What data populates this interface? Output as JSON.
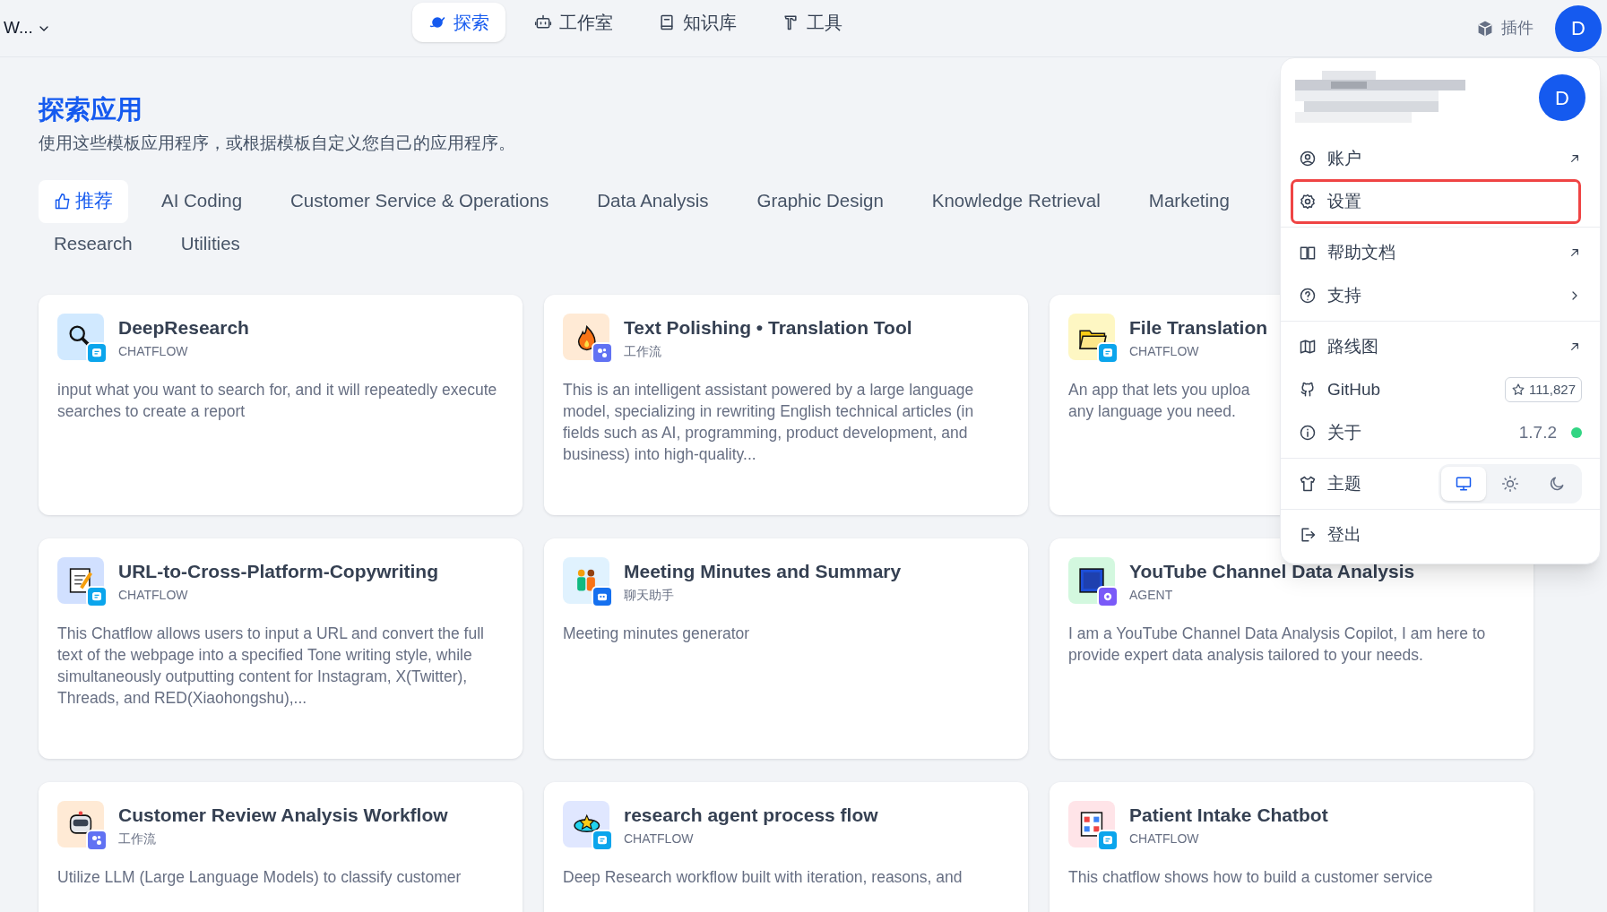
{
  "workspace": {
    "name": "W..."
  },
  "nav": [
    {
      "label": "探索",
      "selected": true
    },
    {
      "label": "工作室",
      "selected": false
    },
    {
      "label": "知识库",
      "selected": false
    },
    {
      "label": "工具",
      "selected": false
    }
  ],
  "plugins": {
    "label": "插件"
  },
  "avatar": {
    "initial": "D"
  },
  "page": {
    "title": "探索应用",
    "subtitle": "使用这些模板应用程序，或根据模板自定义您自己的应用程序。"
  },
  "categories": [
    {
      "label": "推荐",
      "selected": true
    },
    {
      "label": "AI Coding",
      "selected": false
    },
    {
      "label": "Customer Service & Operations",
      "selected": false
    },
    {
      "label": "Data Analysis",
      "selected": false
    },
    {
      "label": "Graphic Design",
      "selected": false
    },
    {
      "label": "Knowledge Retrieval",
      "selected": false
    },
    {
      "label": "Marketing",
      "selected": false
    },
    {
      "label": "Research",
      "selected": false
    },
    {
      "label": "Utilities",
      "selected": false
    }
  ],
  "apps": [
    {
      "name": "DeepResearch",
      "type": "CHATFLOW",
      "kind": "chatflow",
      "color": "#d1e9ff",
      "description": "input what you want to search for, and it will repeatedly execute searches to create a report"
    },
    {
      "name": "Text Polishing • Translation Tool",
      "type": "工作流",
      "kind": "workflow",
      "color": "#ffead5",
      "description": "This is an intelligent assistant powered by a large language model, specializing in rewriting English technical articles (in fields such as AI, programming, product development, and business) into high-quality..."
    },
    {
      "name": "File Translation",
      "type": "CHATFLOW",
      "kind": "chatflow",
      "color": "#fef7c3",
      "description": "An app that lets you uploa\nany language you need."
    },
    {
      "name": "URL-to-Cross-Platform-Copywriting",
      "type": "CHATFLOW",
      "kind": "chatflow",
      "color": "#d1e0ff",
      "description": "This Chatflow allows users to input a URL and convert the full text of the webpage into a specified Tone writing style, while simultaneously outputting content for Instagram, X(Twitter), Threads, and RED(Xiaohongshu),..."
    },
    {
      "name": "Meeting Minutes and Summary",
      "type": "聊天助手",
      "kind": "chat",
      "color": "#e0f2fe",
      "description": "Meeting minutes generator"
    },
    {
      "name": "YouTube Channel Data Analysis",
      "type": "AGENT",
      "kind": "agent",
      "color": "#d3f8df",
      "description": "I am a YouTube Channel Data Analysis Copilot, I am here to provide expert data analysis tailored to your needs."
    },
    {
      "name": "Customer Review Analysis Workflow",
      "type": "工作流",
      "kind": "workflow",
      "color": "#ffead5",
      "description": "Utilize LLM (Large Language Models) to classify customer"
    },
    {
      "name": "research agent process flow",
      "type": "CHATFLOW",
      "kind": "chatflow",
      "color": "#e0e7ff",
      "description": "Deep Research workflow built with iteration, reasons, and"
    },
    {
      "name": "Patient Intake Chatbot",
      "type": "CHATFLOW",
      "kind": "chatflow",
      "color": "#ffe4e8",
      "description": "This chatflow shows how to build a customer service"
    }
  ],
  "menu": {
    "avatar": "D",
    "groups": [
      [
        {
          "label": "账户",
          "kind": "external",
          "highlighted": false
        },
        {
          "label": "设置",
          "kind": "plain",
          "highlighted": true
        }
      ],
      [
        {
          "label": "帮助文档",
          "kind": "external",
          "highlighted": false
        },
        {
          "label": "支持",
          "kind": "submenu",
          "highlighted": false
        }
      ],
      [
        {
          "label": "路线图",
          "kind": "external",
          "highlighted": false
        },
        {
          "label": "GitHub",
          "kind": "stars",
          "value": "111,827",
          "highlighted": false
        },
        {
          "label": "关于",
          "kind": "version",
          "value": "1.7.2",
          "color": "#32d583",
          "highlighted": false
        }
      ],
      [
        {
          "label": "主题",
          "kind": "theme",
          "highlighted": false,
          "options": [
            {
              "selected": true
            },
            {
              "selected": false
            },
            {
              "selected": false
            }
          ]
        }
      ],
      [
        {
          "label": "登出",
          "kind": "plain",
          "highlighted": false
        }
      ]
    ]
  }
}
